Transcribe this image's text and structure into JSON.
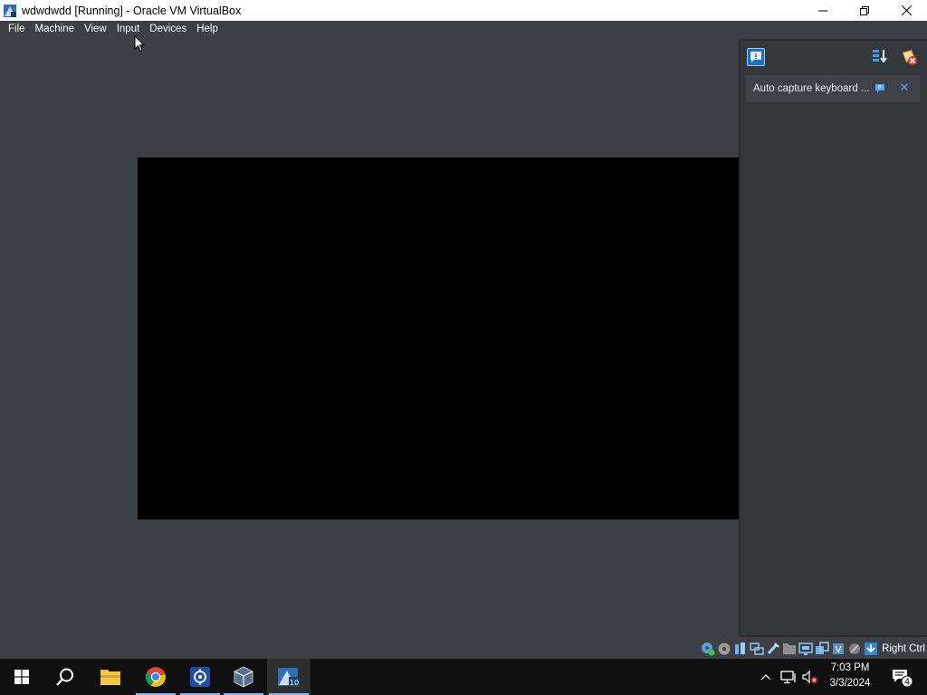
{
  "window": {
    "title": "wdwdwdd [Running] - Oracle VM VirtualBox"
  },
  "menu": {
    "items": [
      "File",
      "Machine",
      "View",
      "Input",
      "Devices",
      "Help"
    ]
  },
  "notification_center": {
    "message": "Auto capture keyboard ...",
    "close_glyph": "✕"
  },
  "statusbar": {
    "host_key": "Right Ctrl",
    "icons": [
      "hard-disk-icon",
      "optical-drive-icon",
      "audio-icon",
      "network-icon",
      "usb-icon",
      "shared-folders-icon",
      "display-icon",
      "recording-icon",
      "cpu-icon",
      "mouse-integration-icon",
      "keyboard-capture-icon"
    ]
  },
  "taskbar": {
    "apps": [
      "start-icon",
      "search-icon",
      "file-explorer-icon",
      "chrome-icon",
      "network-app-icon",
      "virtualbox-manager-icon",
      "virtualbox-vm-icon"
    ],
    "active_app": "virtualbox-vm-icon"
  },
  "clock": {
    "time": "7:03 PM",
    "date": "3/3/2024"
  },
  "action_center": {
    "badge_count": "4"
  },
  "colors": {
    "accent": "#1f6fbf",
    "background": "#3c3f43",
    "taskbar": "#101010"
  }
}
